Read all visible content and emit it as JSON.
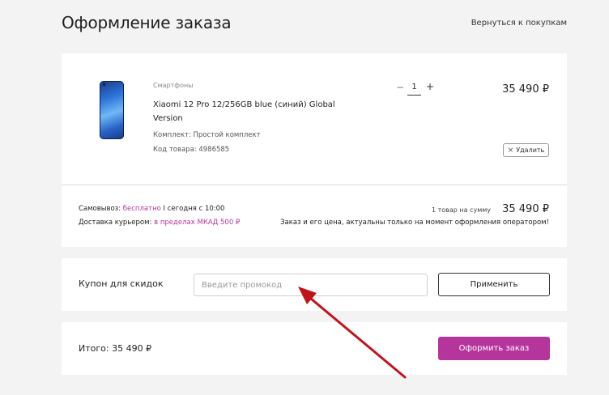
{
  "header": {
    "title": "Оформление заказа",
    "back_link": "Вернуться к покупкам"
  },
  "cart": {
    "items": [
      {
        "category": "Смартфоны",
        "name": "Xiaomi 12 Pro 12/256GB blue (синий) Global Version",
        "kit": "Комплект: Простой комплект",
        "code": "Код товара: 4986585",
        "quantity": "1",
        "minus": "−",
        "plus": "+",
        "price": "35 490 ₽",
        "delete_label": "Удалить",
        "delete_icon": "×"
      }
    ],
    "delivery": {
      "pickup_prefix": "Самовывоз: ",
      "pickup_accent": "бесплатно",
      "pickup_suffix": " I сегодня с 10:00",
      "courier_prefix": "Доставка курьером: ",
      "courier_accent": "в пределах МКАД 500 ₽"
    },
    "summary": {
      "label": "1 товар на сумму",
      "value": "35 490 ₽",
      "note": "Заказ и его цена, актуальны только на момент оформления оператором!"
    }
  },
  "coupon": {
    "label": "Купон для скидок",
    "placeholder": "Введите промокод",
    "value": "",
    "apply_label": "Применить"
  },
  "total": {
    "label": "Итого: 35 490 ₽",
    "order_label": "Оформить заказ"
  },
  "colors": {
    "accent": "#b6359c",
    "annotation_arrow": "#c0141a"
  }
}
